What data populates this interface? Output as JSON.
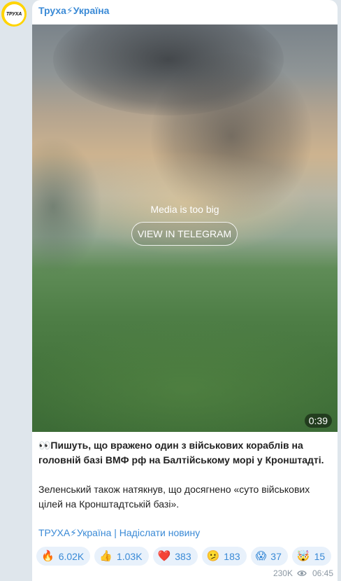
{
  "channel": {
    "avatar_text": "ТРУХА",
    "title": "Труха⚡Україна"
  },
  "media": {
    "caption": "Media is too big",
    "button_label": "VIEW IN TELEGRAM",
    "duration": "0:39"
  },
  "post": {
    "paragraph1": "👀Пишуть, що вражено один з військових кораблів на головній базі ВМФ рф на Балтійському морі у Кронштадті.",
    "paragraph2": "Зеленський також натякнув, що досягнено «суто військових цілей на Кронштадтській базі».",
    "footer_link": "ТРУХА⚡Україна | Надіслати новину"
  },
  "reactions": [
    {
      "icon": "fire-icon",
      "emoji": "🔥",
      "count": "6.02K"
    },
    {
      "icon": "thumbs-up-icon",
      "emoji": "👍",
      "count": "1.03K"
    },
    {
      "icon": "heart-icon",
      "emoji": "❤️",
      "count": "383"
    },
    {
      "icon": "confused-face-icon",
      "emoji": "🫤",
      "count": "183"
    },
    {
      "icon": "screaming-face-icon",
      "emoji": "😱",
      "count": "37"
    },
    {
      "icon": "exploding-head-icon",
      "emoji": "🤯",
      "count": "15"
    }
  ],
  "meta": {
    "views": "230K",
    "time": "06:45"
  },
  "colors": {
    "accent": "#3a8ad6",
    "avatar_ring": "#ffd400",
    "reaction_bg": "#e8f1fb",
    "background": "#dfe6ec"
  }
}
